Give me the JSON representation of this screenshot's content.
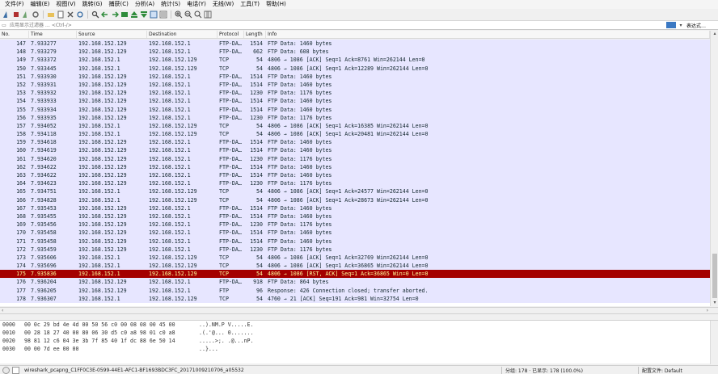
{
  "menu": [
    "文件(F)",
    "编辑(E)",
    "视图(V)",
    "跳转(G)",
    "捕获(C)",
    "分析(A)",
    "统计(S)",
    "电话(Y)",
    "无线(W)",
    "工具(T)",
    "帮助(H)"
  ],
  "filter": {
    "placeholder": "应用显示过滤器 … <Ctrl-/>",
    "expression_label": "表达式…"
  },
  "columns": {
    "no": "No.",
    "time": "Time",
    "source": "Source",
    "destination": "Destination",
    "protocol": "Protocol",
    "length": "Length",
    "info": "Info"
  },
  "packets": [
    {
      "no": "147",
      "time": "7.933277",
      "src": "192.168.152.129",
      "dst": "192.168.152.1",
      "proto": "FTP-DA…",
      "len": "1514",
      "info": "FTP Data: 1460 bytes",
      "kind": "ftp"
    },
    {
      "no": "148",
      "time": "7.933279",
      "src": "192.168.152.129",
      "dst": "192.168.152.1",
      "proto": "FTP-DA…",
      "len": "662",
      "info": "FTP Data: 608 bytes",
      "kind": "ftp"
    },
    {
      "no": "149",
      "time": "7.933372",
      "src": "192.168.152.1",
      "dst": "192.168.152.129",
      "proto": "TCP",
      "len": "54",
      "info": "4806 → 1086 [ACK] Seq=1 Ack=8761 Win=262144 Len=0",
      "kind": "tcp"
    },
    {
      "no": "150",
      "time": "7.933445",
      "src": "192.168.152.1",
      "dst": "192.168.152.129",
      "proto": "TCP",
      "len": "54",
      "info": "4806 → 1086 [ACK] Seq=1 Ack=12289 Win=262144 Len=0",
      "kind": "tcp"
    },
    {
      "no": "151",
      "time": "7.933930",
      "src": "192.168.152.129",
      "dst": "192.168.152.1",
      "proto": "FTP-DA…",
      "len": "1514",
      "info": "FTP Data: 1460 bytes",
      "kind": "ftp"
    },
    {
      "no": "152",
      "time": "7.933931",
      "src": "192.168.152.129",
      "dst": "192.168.152.1",
      "proto": "FTP-DA…",
      "len": "1514",
      "info": "FTP Data: 1460 bytes",
      "kind": "ftp"
    },
    {
      "no": "153",
      "time": "7.933932",
      "src": "192.168.152.129",
      "dst": "192.168.152.1",
      "proto": "FTP-DA…",
      "len": "1230",
      "info": "FTP Data: 1176 bytes",
      "kind": "ftp"
    },
    {
      "no": "154",
      "time": "7.933933",
      "src": "192.168.152.129",
      "dst": "192.168.152.1",
      "proto": "FTP-DA…",
      "len": "1514",
      "info": "FTP Data: 1460 bytes",
      "kind": "ftp"
    },
    {
      "no": "155",
      "time": "7.933934",
      "src": "192.168.152.129",
      "dst": "192.168.152.1",
      "proto": "FTP-DA…",
      "len": "1514",
      "info": "FTP Data: 1460 bytes",
      "kind": "ftp"
    },
    {
      "no": "156",
      "time": "7.933935",
      "src": "192.168.152.129",
      "dst": "192.168.152.1",
      "proto": "FTP-DA…",
      "len": "1230",
      "info": "FTP Data: 1176 bytes",
      "kind": "ftp"
    },
    {
      "no": "157",
      "time": "7.934052",
      "src": "192.168.152.1",
      "dst": "192.168.152.129",
      "proto": "TCP",
      "len": "54",
      "info": "4806 → 1086 [ACK] Seq=1 Ack=16385 Win=262144 Len=0",
      "kind": "tcp"
    },
    {
      "no": "158",
      "time": "7.934118",
      "src": "192.168.152.1",
      "dst": "192.168.152.129",
      "proto": "TCP",
      "len": "54",
      "info": "4806 → 1086 [ACK] Seq=1 Ack=20481 Win=262144 Len=0",
      "kind": "tcp"
    },
    {
      "no": "159",
      "time": "7.934618",
      "src": "192.168.152.129",
      "dst": "192.168.152.1",
      "proto": "FTP-DA…",
      "len": "1514",
      "info": "FTP Data: 1460 bytes",
      "kind": "ftp"
    },
    {
      "no": "160",
      "time": "7.934619",
      "src": "192.168.152.129",
      "dst": "192.168.152.1",
      "proto": "FTP-DA…",
      "len": "1514",
      "info": "FTP Data: 1460 bytes",
      "kind": "ftp"
    },
    {
      "no": "161",
      "time": "7.934620",
      "src": "192.168.152.129",
      "dst": "192.168.152.1",
      "proto": "FTP-DA…",
      "len": "1230",
      "info": "FTP Data: 1176 bytes",
      "kind": "ftp"
    },
    {
      "no": "162",
      "time": "7.934622",
      "src": "192.168.152.129",
      "dst": "192.168.152.1",
      "proto": "FTP-DA…",
      "len": "1514",
      "info": "FTP Data: 1460 bytes",
      "kind": "ftp"
    },
    {
      "no": "163",
      "time": "7.934622",
      "src": "192.168.152.129",
      "dst": "192.168.152.1",
      "proto": "FTP-DA…",
      "len": "1514",
      "info": "FTP Data: 1460 bytes",
      "kind": "ftp"
    },
    {
      "no": "164",
      "time": "7.934623",
      "src": "192.168.152.129",
      "dst": "192.168.152.1",
      "proto": "FTP-DA…",
      "len": "1230",
      "info": "FTP Data: 1176 bytes",
      "kind": "ftp"
    },
    {
      "no": "165",
      "time": "7.934751",
      "src": "192.168.152.1",
      "dst": "192.168.152.129",
      "proto": "TCP",
      "len": "54",
      "info": "4806 → 1086 [ACK] Seq=1 Ack=24577 Win=262144 Len=0",
      "kind": "tcp"
    },
    {
      "no": "166",
      "time": "7.934828",
      "src": "192.168.152.1",
      "dst": "192.168.152.129",
      "proto": "TCP",
      "len": "54",
      "info": "4806 → 1086 [ACK] Seq=1 Ack=28673 Win=262144 Len=0",
      "kind": "tcp"
    },
    {
      "no": "167",
      "time": "7.935453",
      "src": "192.168.152.129",
      "dst": "192.168.152.1",
      "proto": "FTP-DA…",
      "len": "1514",
      "info": "FTP Data: 1460 bytes",
      "kind": "ftp"
    },
    {
      "no": "168",
      "time": "7.935455",
      "src": "192.168.152.129",
      "dst": "192.168.152.1",
      "proto": "FTP-DA…",
      "len": "1514",
      "info": "FTP Data: 1460 bytes",
      "kind": "ftp"
    },
    {
      "no": "169",
      "time": "7.935456",
      "src": "192.168.152.129",
      "dst": "192.168.152.1",
      "proto": "FTP-DA…",
      "len": "1230",
      "info": "FTP Data: 1176 bytes",
      "kind": "ftp"
    },
    {
      "no": "170",
      "time": "7.935458",
      "src": "192.168.152.129",
      "dst": "192.168.152.1",
      "proto": "FTP-DA…",
      "len": "1514",
      "info": "FTP Data: 1460 bytes",
      "kind": "ftp"
    },
    {
      "no": "171",
      "time": "7.935458",
      "src": "192.168.152.129",
      "dst": "192.168.152.1",
      "proto": "FTP-DA…",
      "len": "1514",
      "info": "FTP Data: 1460 bytes",
      "kind": "ftp"
    },
    {
      "no": "172",
      "time": "7.935459",
      "src": "192.168.152.129",
      "dst": "192.168.152.1",
      "proto": "FTP-DA…",
      "len": "1230",
      "info": "FTP Data: 1176 bytes",
      "kind": "ftp"
    },
    {
      "no": "173",
      "time": "7.935606",
      "src": "192.168.152.1",
      "dst": "192.168.152.129",
      "proto": "TCP",
      "len": "54",
      "info": "4806 → 1086 [ACK] Seq=1 Ack=32769 Win=262144 Len=0",
      "kind": "tcp"
    },
    {
      "no": "174",
      "time": "7.935696",
      "src": "192.168.152.1",
      "dst": "192.168.152.129",
      "proto": "TCP",
      "len": "54",
      "info": "4806 → 1086 [ACK] Seq=1 Ack=36865 Win=262144 Len=0",
      "kind": "tcp"
    },
    {
      "no": "175",
      "time": "7.935836",
      "src": "192.168.152.1",
      "dst": "192.168.152.129",
      "proto": "TCP",
      "len": "54",
      "info": "4806 → 1086 [RST, ACK] Seq=1 Ack=36865 Win=0 Len=0",
      "kind": "rst"
    },
    {
      "no": "176",
      "time": "7.936204",
      "src": "192.168.152.129",
      "dst": "192.168.152.1",
      "proto": "FTP-DA…",
      "len": "918",
      "info": "FTP Data: 864 bytes",
      "kind": "ftp"
    },
    {
      "no": "177",
      "time": "7.936205",
      "src": "192.168.152.129",
      "dst": "192.168.152.1",
      "proto": "FTP",
      "len": "96",
      "info": "Response: 426 Connection closed; transfer aborted.",
      "kind": "ftp"
    },
    {
      "no": "178",
      "time": "7.936307",
      "src": "192.168.152.1",
      "dst": "192.168.152.129",
      "proto": "TCP",
      "len": "54",
      "info": "4760 → 21 [ACK] Seq=191 Ack=981 Win=32754 Len=0",
      "kind": "tcp"
    }
  ],
  "hex_dump": [
    {
      "offset": "0000",
      "bytes": "00 0c 29 bd 4e 4d 00 50  56 c0 00 08 08 00 45 00",
      "ascii": "..).NM.P V.....E."
    },
    {
      "offset": "0010",
      "bytes": "00 28 18 27 40 00 80 06  30 d5 c0 a8 98 01 c0 a8",
      "ascii": ".(.'@... 0......."
    },
    {
      "offset": "0020",
      "bytes": "98 81 12 c6 04 3e 3b 7f  85 40 1f dc 88 6e 50 14",
      "ascii": ".....>;. .@...nP."
    },
    {
      "offset": "0030",
      "bytes": "00 00 7d ee 00 00",
      "ascii": "..}..."
    }
  ],
  "status": {
    "file": "wireshark_pcapng_C1FF0C3E-0599-44E1-AFC1-BF1693BDC3FC_20171009210706_a05532",
    "stats": "分组: 178 · 已显示: 178 (100.0%)",
    "profile": "配置文件: Default"
  },
  "colors": {
    "row_default": "#e7e6ff",
    "row_rst_bg": "#a40000",
    "row_rst_fg": "#fffc9c"
  },
  "toolbar_icons": [
    "shark-fin-start-icon",
    "stop-icon",
    "restart-icon",
    "options-gear-icon",
    "open-folder-icon",
    "save-icon",
    "close-file-icon",
    "reload-icon",
    "find-icon",
    "back-arrow-icon",
    "forward-arrow-icon",
    "goto-packet-icon",
    "first-packet-icon",
    "last-packet-icon",
    "autoscroll-icon",
    "colorize-icon",
    "zoom-in-icon",
    "zoom-out-icon",
    "zoom-normal-icon",
    "resize-columns-icon"
  ]
}
